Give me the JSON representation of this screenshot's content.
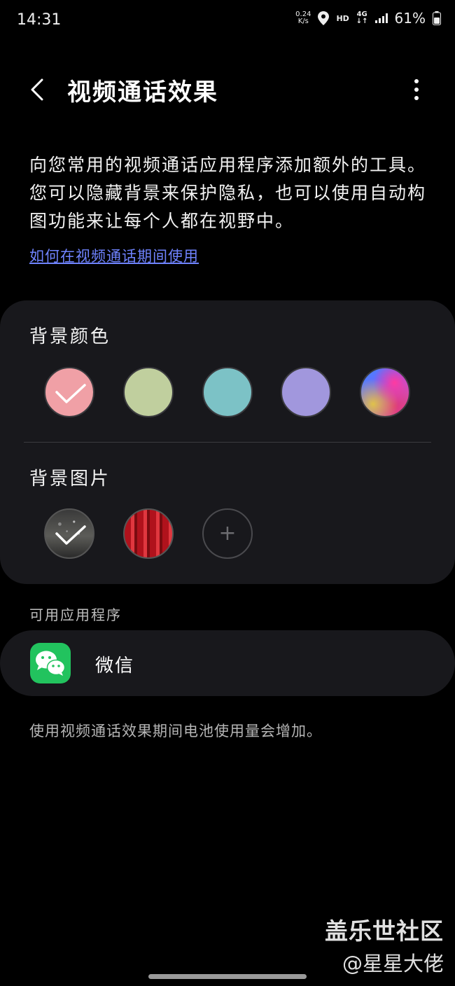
{
  "status_bar": {
    "time": "14:31",
    "net_speed_value": "0.24",
    "net_speed_unit": "K/s",
    "hd": "HD",
    "network": "4G",
    "battery": "61%"
  },
  "header": {
    "title": "视频通话效果"
  },
  "description": "向您常用的视频通话应用程序添加额外的工具。您可以隐藏背景来保护隐私，也可以使用自动构图功能来让每个人都在视野中。",
  "help_link": "如何在视频通话期间使用",
  "background_color": {
    "label": "背景颜色",
    "colors": [
      "#f0a0a6",
      "#c0cf9e",
      "#7cc2c6",
      "#a197dd",
      "gradient"
    ],
    "selected_index": 0
  },
  "background_image": {
    "label": "背景图片",
    "selected_index": 0,
    "add_symbol": "+"
  },
  "available_apps": {
    "label": "可用应用程序",
    "apps": [
      {
        "name": "微信",
        "icon": "wechat-icon"
      }
    ]
  },
  "footer_note": "使用视频通话效果期间电池使用量会增加。",
  "watermark": {
    "line1": "盖乐世社区",
    "line2": "@星星大佬"
  }
}
